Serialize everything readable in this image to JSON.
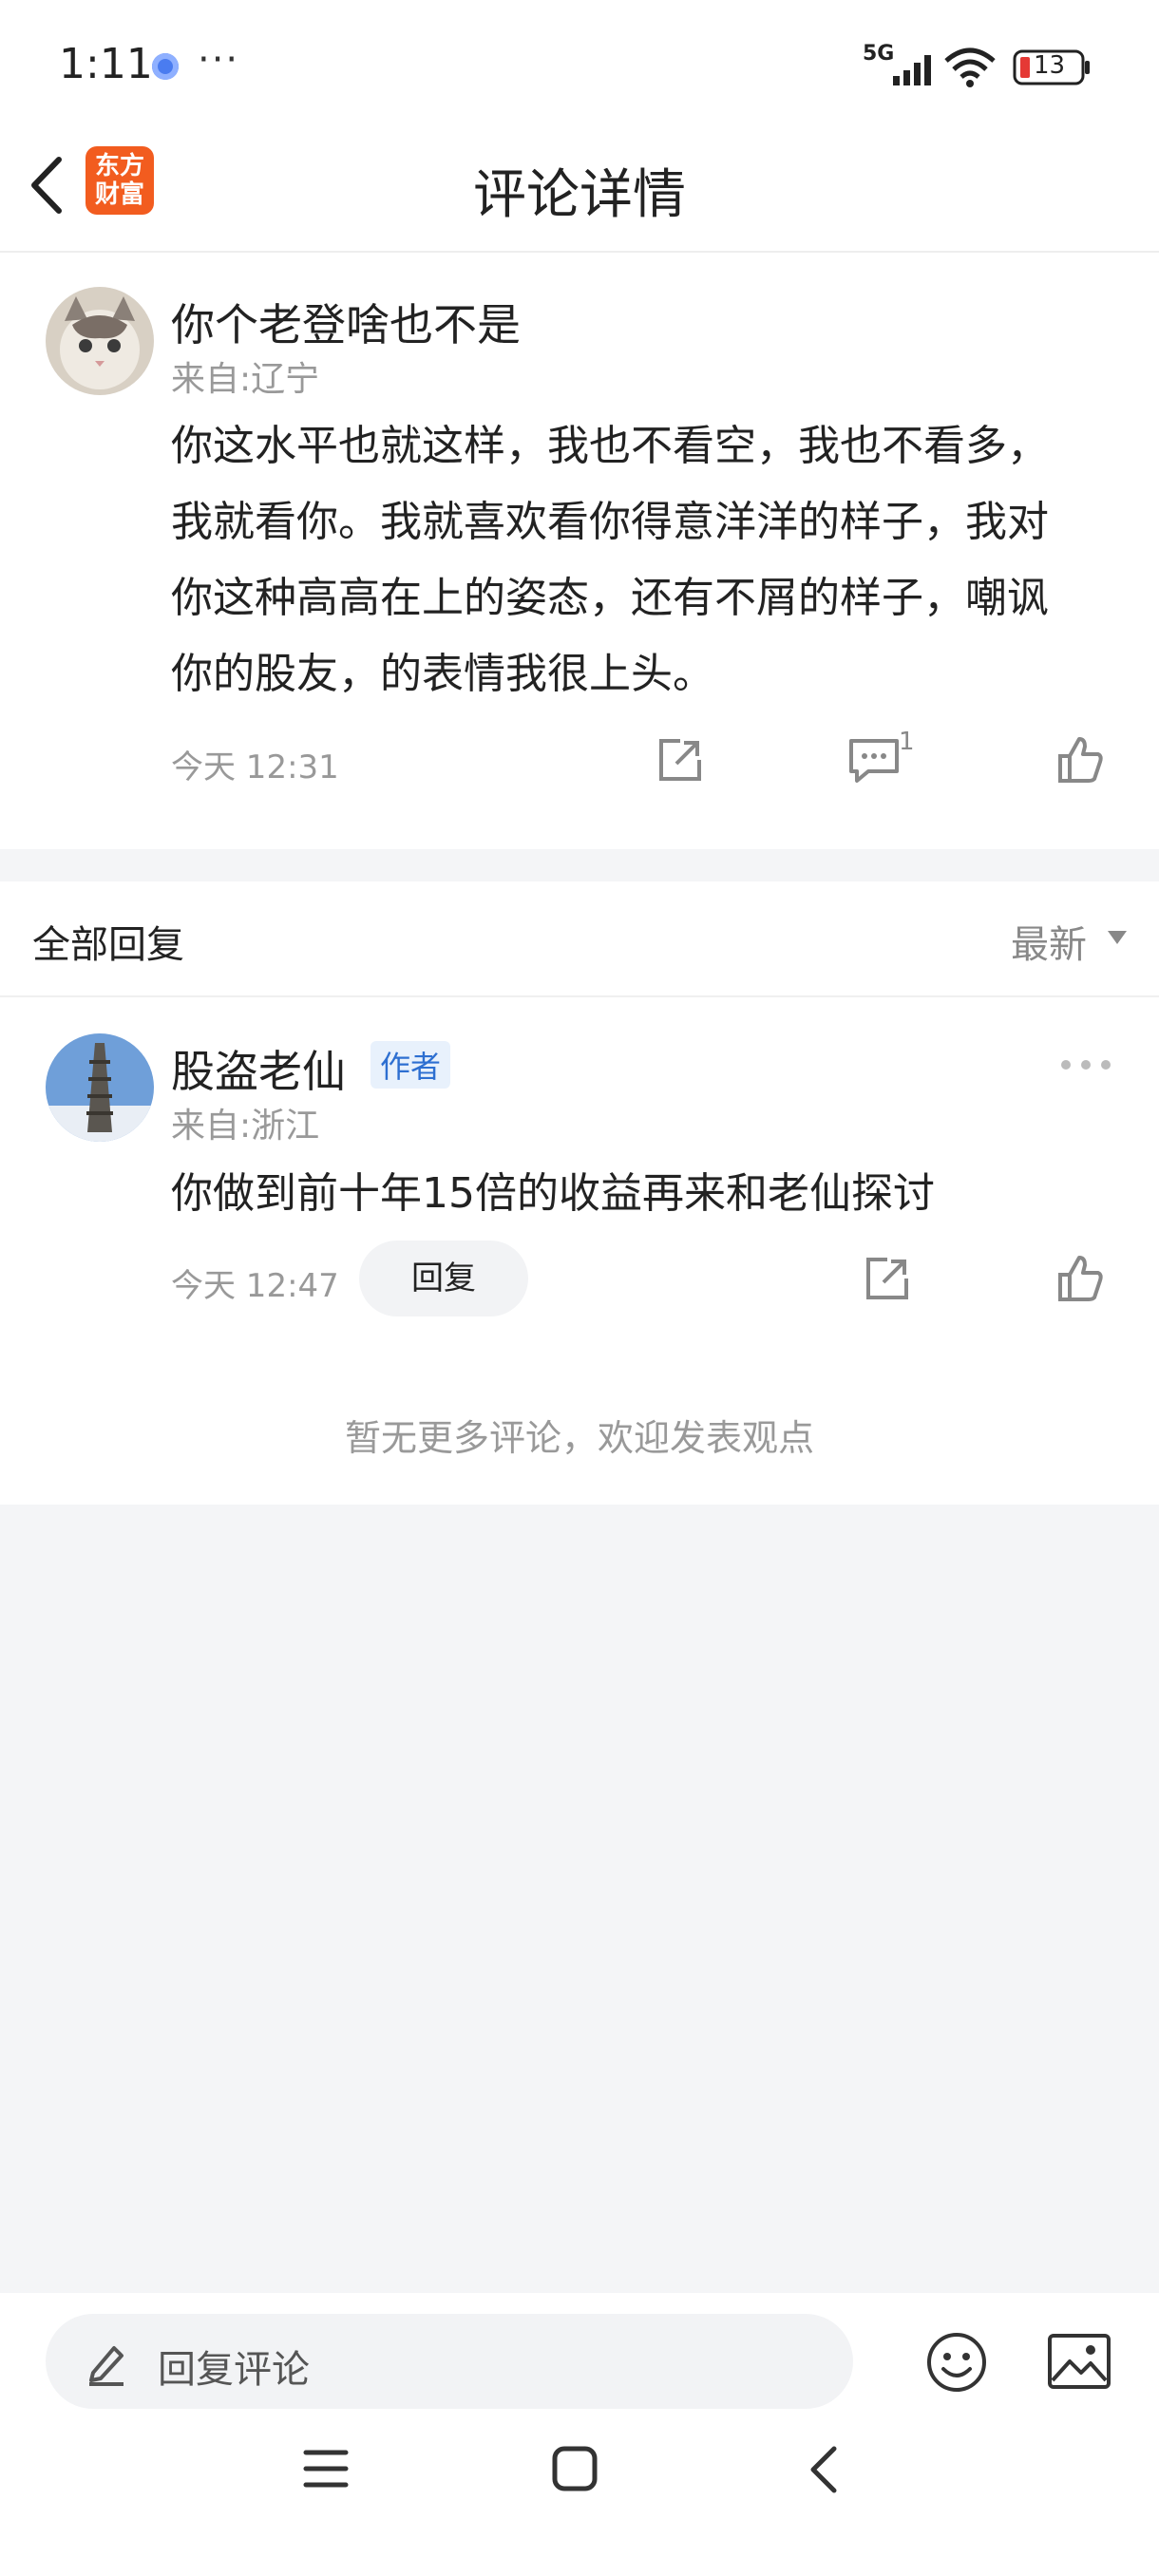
{
  "status_bar": {
    "time": "1:11",
    "more": "···",
    "network": "5G",
    "battery": "13"
  },
  "header": {
    "logo_line1": "东方",
    "logo_line2": "财富",
    "title": "评论详情"
  },
  "comment": {
    "username": "你个老登啥也不是",
    "location": "来自:辽宁",
    "lines": [
      "你这水平也就这样，我也不看空，我也不看多，",
      "我就看你。我就喜欢看你得意洋洋的样子，我对",
      "你这种高高在上的姿态，还有不屑的样子，嘲讽",
      "你的股友，的表情我很上头。"
    ],
    "time": "今天 12:31",
    "reply_count": "1"
  },
  "replies": {
    "title": "全部回复",
    "sort_label": "最新",
    "items": [
      {
        "username": "股盗老仙",
        "badge": "作者",
        "location": "来自:浙江",
        "text": "你做到前十年15倍的收益再来和老仙探讨",
        "time": "今天 12:47",
        "reply_label": "回复"
      }
    ],
    "no_more": "暂无更多评论，欢迎发表观点"
  },
  "bottom": {
    "input_placeholder": "回复评论"
  },
  "colors": {
    "brand": "#f25c1f",
    "badge_text": "#2d6fd1",
    "muted": "#999999",
    "background": "#f4f5f7"
  }
}
